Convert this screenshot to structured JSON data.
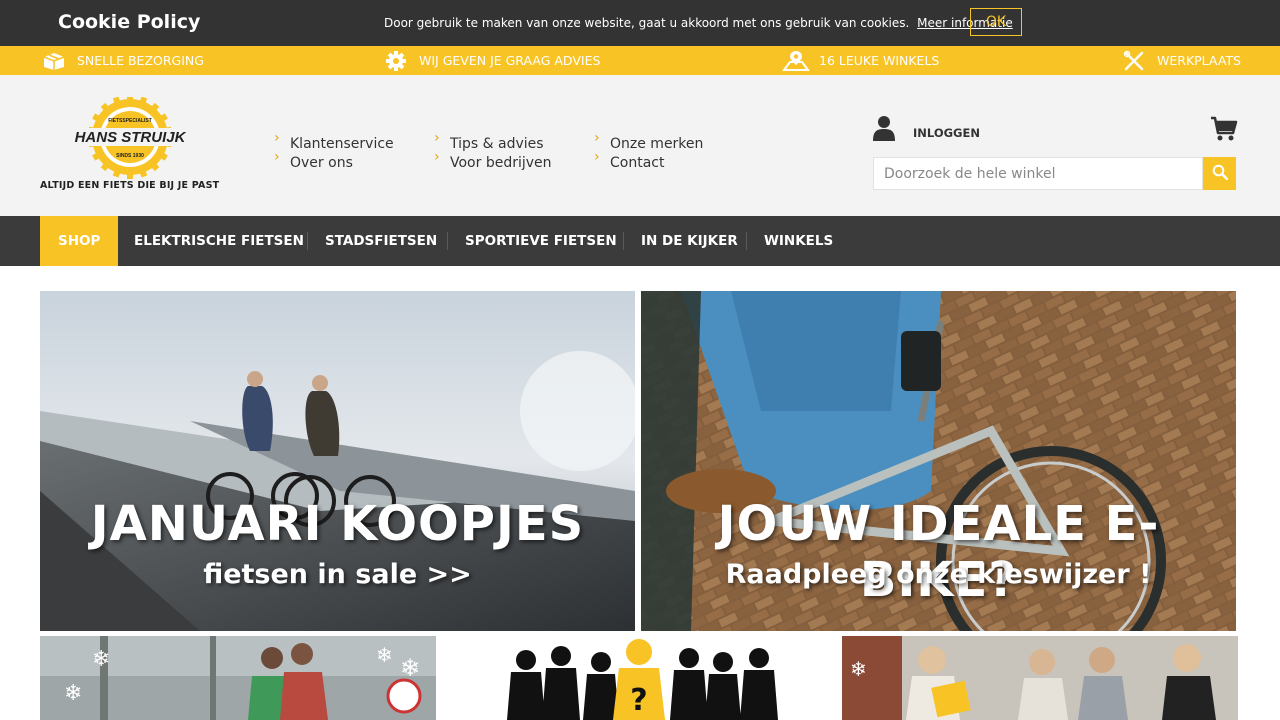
{
  "cookie": {
    "title": "Cookie Policy",
    "text": "Door gebruik te maken van onze website, gaat u akkoord met ons gebruik van cookies.",
    "link": "Meer informatie",
    "ok": "OK"
  },
  "usp": [
    {
      "label": "SNELLE BEZORGING",
      "icon": "box-icon"
    },
    {
      "label": "WIJ GEVEN JE GRAAG ADVIES",
      "icon": "gear-icon"
    },
    {
      "label": "16 LEUKE WINKELS",
      "icon": "map-pin-icon"
    },
    {
      "label": "WERKPLAATS",
      "icon": "tools-icon"
    }
  ],
  "brand": {
    "name": "HANS STRUIJK",
    "ring_top": "FIETSSPECIALIST",
    "ring_bottom": "SINDS 1930",
    "tagline": "ALTIJD EEN FIETS DIE BIJ JE PAST"
  },
  "toplinks": [
    [
      "Klantenservice",
      "Over ons"
    ],
    [
      "Tips & advies",
      "Voor bedrijven"
    ],
    [
      "Onze merken",
      "Contact"
    ]
  ],
  "account": {
    "login": "INLOGGEN"
  },
  "search": {
    "placeholder": "Doorzoek de hele winkel"
  },
  "nav": [
    "SHOP",
    "ELEKTRISCHE FIETSEN",
    "STADSFIETSEN",
    "SPORTIEVE FIETSEN",
    "IN DE KIJKER",
    "WINKELS"
  ],
  "banners": [
    {
      "title": "JANUARI KOOPJES",
      "subtitle": "fietsen in sale >>"
    },
    {
      "title": "JOUW IDEALE E-BIKE?",
      "subtitle": "Raadpleeg onze kieswijzer !"
    }
  ],
  "colors": {
    "accent": "#f7c325",
    "dark": "#333333",
    "nav": "#3b3b3b",
    "header_bg": "#f3f3f3"
  }
}
